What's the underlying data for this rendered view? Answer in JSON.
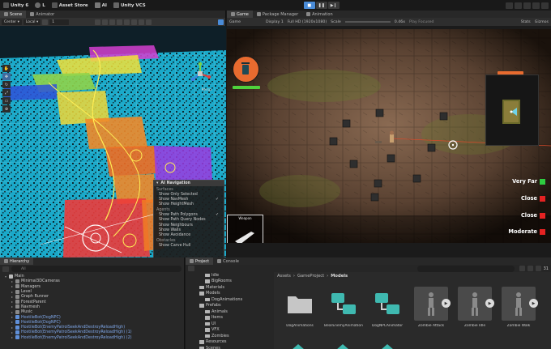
{
  "topbar": {
    "app_label": "Unity 6",
    "account_label": "L",
    "asset_store_label": "Asset Store",
    "ai_label": "AI",
    "vcs_label": "Unity VCS"
  },
  "scene": {
    "tabs": [
      {
        "label": "Scene"
      },
      {
        "label": "Animator"
      }
    ],
    "pivot_mode": "Center",
    "space_mode": "Local",
    "snap_value": "1",
    "persp_label": "Persp",
    "nav_overlay": {
      "title": "AI Navigation",
      "surfaces_header": "Surfaces",
      "surfaces": [
        {
          "label": "Show Only Selected",
          "checked": false
        },
        {
          "label": "Show NavMesh",
          "checked": true
        },
        {
          "label": "Show HeightMesh",
          "checked": false
        }
      ],
      "agents_header": "Agents",
      "agents": [
        {
          "label": "Show Path Polygons",
          "checked": true
        },
        {
          "label": "Show Path Query Nodes",
          "checked": false
        },
        {
          "label": "Show Neighbours",
          "checked": false
        },
        {
          "label": "Show Walls",
          "checked": false
        },
        {
          "label": "Show Avoidance",
          "checked": false
        }
      ],
      "obstacles_header": "Obstacles",
      "obstacles": [
        {
          "label": "Show Carve Hull",
          "checked": false
        }
      ]
    }
  },
  "game": {
    "tabs": [
      {
        "label": "Game"
      },
      {
        "label": "Package Manager"
      },
      {
        "label": "Animation"
      }
    ],
    "mode": "Game",
    "display": "Display 1",
    "resolution": "Full HD (1920x1080)",
    "scale_label": "Scale",
    "scale_value": "0.46x",
    "play_focused": "Play Focused",
    "stats_label": "Stats",
    "gizmos_label": "Gizmos",
    "inventory_title": "Weapon",
    "inventory_count": "20",
    "range_labels": [
      {
        "label": "Very Far",
        "color": "#2ecc40"
      },
      {
        "label": "Close",
        "color": "#e52222"
      },
      {
        "label": "Close",
        "color": "#e52222"
      },
      {
        "label": "Moderate",
        "color": "#e52222"
      }
    ]
  },
  "hierarchy": {
    "tab_label": "Hierarchy",
    "search_placeholder": "All",
    "rows": [
      {
        "label": "Main",
        "indent": 0,
        "blue": false
      },
      {
        "label": "Minimal3DCameras",
        "indent": 1,
        "blue": false
      },
      {
        "label": "Managers",
        "indent": 1,
        "blue": false
      },
      {
        "label": "Level",
        "indent": 1,
        "blue": false
      },
      {
        "label": "Graph Runner",
        "indent": 1,
        "blue": false
      },
      {
        "label": "ForestParent",
        "indent": 1,
        "blue": false
      },
      {
        "label": "Navmesh",
        "indent": 1,
        "blue": false
      },
      {
        "label": "Music",
        "indent": 1,
        "blue": false
      },
      {
        "label": "HostileBot(DogNPC)",
        "indent": 1,
        "blue": true
      },
      {
        "label": "HostileBot(DogNPC)",
        "indent": 1,
        "blue": true
      },
      {
        "label": "HostileBot(EnemyPatrolSeekAndDestroyReloadHigh)",
        "indent": 1,
        "blue": true
      },
      {
        "label": "HostileBot(EnemyPatrolSeekAndDestroyReloadHigh) (1)",
        "indent": 1,
        "blue": true
      },
      {
        "label": "HostileBot(EnemyPatrolSeekAndDestroyReloadHigh) (2)",
        "indent": 1,
        "blue": true
      }
    ]
  },
  "project": {
    "tabs": [
      {
        "label": "Project"
      },
      {
        "label": "Console"
      }
    ],
    "count_badge": "31",
    "tree": [
      {
        "label": "Idle",
        "indent": 2
      },
      {
        "label": "BigRooms",
        "indent": 2
      },
      {
        "label": "Materials",
        "indent": 1
      },
      {
        "label": "Models",
        "indent": 1
      },
      {
        "label": "DogAnimations",
        "indent": 2
      },
      {
        "label": "Prefabs",
        "indent": 1
      },
      {
        "label": "Animals",
        "indent": 2
      },
      {
        "label": "Items",
        "indent": 2
      },
      {
        "label": "UI",
        "indent": 2
      },
      {
        "label": "VFX",
        "indent": 2
      },
      {
        "label": "Zombies",
        "indent": 2
      },
      {
        "label": "Resources",
        "indent": 1
      },
      {
        "label": "Scenes",
        "indent": 1
      },
      {
        "label": "Scripts",
        "indent": 1
      }
    ],
    "breadcrumb": [
      "Assets",
      "GameProject",
      "Models"
    ],
    "assets": [
      {
        "label": "DogAnimations",
        "kind": "folder"
      },
      {
        "label": "BearEnemyAnimation",
        "kind": "controller"
      },
      {
        "label": "DogNPCAnimator",
        "kind": "controller"
      },
      {
        "label": "Zombie Attack",
        "kind": "anim"
      },
      {
        "label": "Zombie Idle",
        "kind": "anim"
      },
      {
        "label": "Zombie Walk",
        "kind": "anim"
      }
    ]
  },
  "colors": {
    "accent": "#4a8cd8",
    "player_portrait": "#e86b2f",
    "health": "#4fd13c",
    "navmesh": "#1fb7d6"
  }
}
